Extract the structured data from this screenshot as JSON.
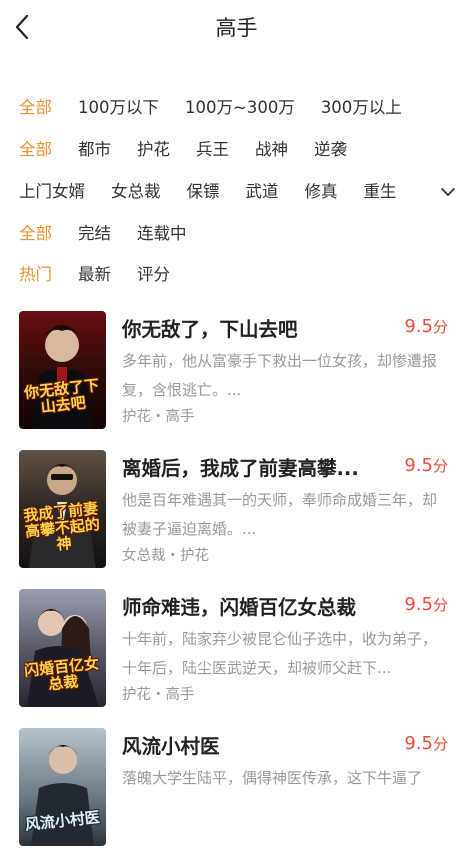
{
  "header": {
    "title": "高手"
  },
  "filters": {
    "words": [
      "全部",
      "100万以下",
      "100万~300万",
      "300万以上"
    ],
    "category": [
      "全部",
      "都市",
      "护花",
      "兵王",
      "战神",
      "逆袭"
    ],
    "tags": [
      "上门女婿",
      "女总裁",
      "保镖",
      "武道",
      "修真",
      "重生"
    ],
    "status": [
      "全部",
      "完结",
      "连载中"
    ],
    "sort": [
      "热门",
      "最新",
      "评分"
    ]
  },
  "books": [
    {
      "title": "你无敌了，下山去吧",
      "score": "9.5",
      "score_unit": "分",
      "desc": "多年前，他从富豪手下救出一位女孩，却惨遭报复，含恨逃亡。...",
      "tags": "护花・高手",
      "cover_text": "你无敌了下山去吧"
    },
    {
      "title": "离婚后，我成了前妻高攀...",
      "score": "9.5",
      "score_unit": "分",
      "desc": "他是百年难遇其一的天师，奉师命成婚三年，却被妻子逼迫离婚。...",
      "tags": "女总裁・护花",
      "cover_text": "我成了前妻高攀不起的神"
    },
    {
      "title": "师命难违，闪婚百亿女总裁",
      "score": "9.5",
      "score_unit": "分",
      "desc": "十年前，陆家弃少被昆仑仙子选中，收为弟子，十年后，陆尘医武逆天，却被师父赶下...",
      "tags": "护花・高手",
      "cover_text": "闪婚百亿女总裁"
    },
    {
      "title": "风流小村医",
      "score": "9.5",
      "score_unit": "分",
      "desc": "落魄大学生陆平，偶得神医传承，这下牛逼了",
      "tags": "",
      "cover_text": "风流小村医"
    }
  ]
}
